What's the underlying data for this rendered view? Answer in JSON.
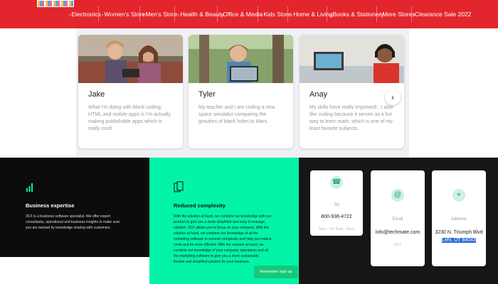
{
  "nav": {
    "items": [
      "Electronics",
      "Women's Store",
      "Men's Store",
      "Health & Beauty",
      "Office & Media",
      "Kids Store",
      "Home & Living",
      "Books & Stationery",
      "More Stores",
      "Clearance Sale 2022"
    ]
  },
  "testimonials": [
    {
      "name": "Jake",
      "quote": "What I'm doing with block coding, HTML and mobile apps is I'm actually making publishable apps which is really cool!"
    },
    {
      "name": "Tyler",
      "quote": "My teacher and I are coding a new space simulator comparing the gravities of black holes to Mars."
    },
    {
      "name": "Anay",
      "quote": "My skills have really improved!...I also like coding because it serves as a fun way to learn math, which is one of my least favorite subjects."
    }
  ],
  "next_icon": "chevron-right-icon",
  "features": {
    "expertise": {
      "icon": "bar-chart-icon",
      "title": "Business expertise",
      "text": "3CX is a business software specialist. We offer expert consultants, operational and business insights to make sure you are backed by knowledge sharing with customers."
    },
    "complexity": {
      "icon": "copy-icon",
      "title": "Reduced complexity",
      "text": "With the solution at hand, we combine our knowledge with our product to give you a more simplified and easy to manage solution. 3CX allows you to focus on your company. With the solution at hand, we combine our knowledge of all the marketing software to remove complexity and help you reduce costs and be more efficient. With the solution at hand, we combine our knowledge of your company, operations and all the marketing software to give you a more sustainable, flexible and simplified solution for your business."
    },
    "newsletter_label": "Newsletter sign up"
  },
  "contact": {
    "phone": {
      "icon": "phone-icon",
      "label": "Tel",
      "value": "800-938-4722",
      "sub": "Mon - Fri 9am - 5pm"
    },
    "email": {
      "icon": "at-icon",
      "label": "Email",
      "value": "info@techmate.com",
      "sub": "24/7"
    },
    "address": {
      "icon": "location-pin-icon",
      "label": "Address",
      "value_line1": "3230 N. Triumph Blvd",
      "value_line2": "Lehi, UT 84043"
    }
  },
  "colors": {
    "nav": "#e3262e",
    "accent_green": "#03f3a8",
    "dark": "#0c0c0c"
  }
}
